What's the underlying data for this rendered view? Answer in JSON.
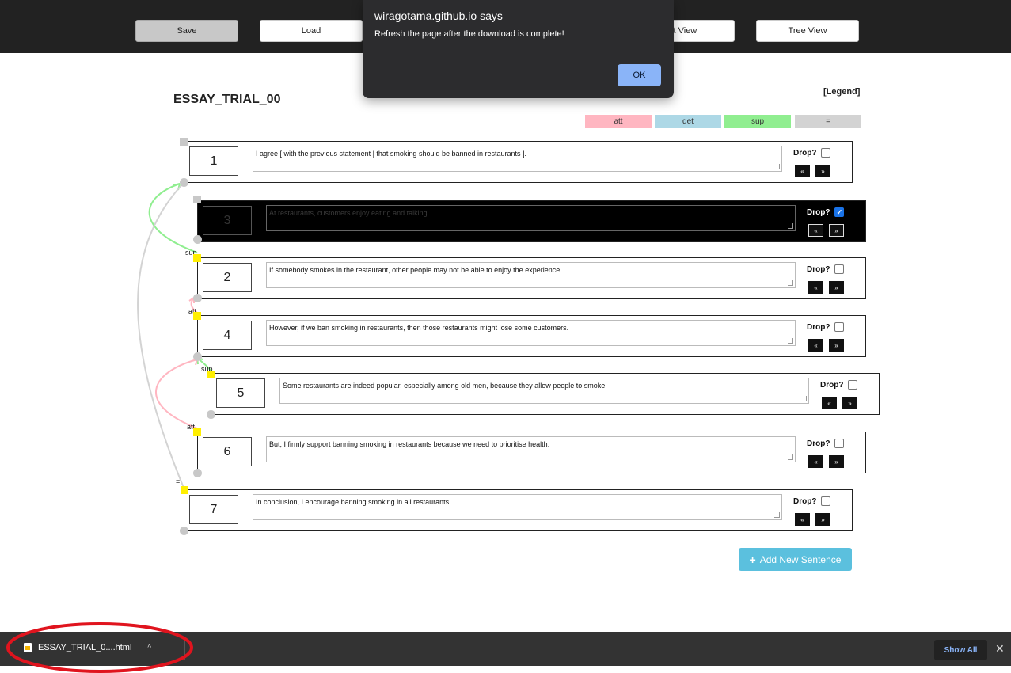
{
  "toolbar": {
    "buttons": [
      {
        "label": "Save"
      },
      {
        "label": "Load"
      },
      {
        "label": "xt View"
      },
      {
        "label": "Tree View"
      }
    ]
  },
  "dialog": {
    "title": "wiragotama.github.io says",
    "message": "Refresh the page after the download is complete!",
    "ok_label": "OK"
  },
  "essay": {
    "title": "ESSAY_TRIAL_00"
  },
  "legend": {
    "label": "[Legend]",
    "chips": [
      {
        "label": "att",
        "color": "#ffb6c1"
      },
      {
        "label": "det",
        "color": "#add8e6"
      },
      {
        "label": "sup",
        "color": "#90ee90"
      },
      {
        "label": "=",
        "color": "#d3d3d3"
      }
    ]
  },
  "sentences": [
    {
      "number": "1",
      "text": "I agree [ with the previous statement | that smoking should be banned in restaurants ].",
      "drop_label": "Drop?",
      "dropped": false,
      "prev_label": "«",
      "next_label": "»"
    },
    {
      "number": "3",
      "text": "At restaurants, customers enjoy eating and talking.",
      "drop_label": "Drop?",
      "dropped": true,
      "prev_label": "«",
      "next_label": "»"
    },
    {
      "number": "2",
      "text": "If somebody smokes in the restaurant, other people may not be able to enjoy the experience.",
      "drop_label": "Drop?",
      "dropped": false,
      "prev_label": "«",
      "next_label": "»"
    },
    {
      "number": "4",
      "text": "However, if we ban smoking in restaurants, then those restaurants might lose some customers.",
      "drop_label": "Drop?",
      "dropped": false,
      "prev_label": "«",
      "next_label": "»"
    },
    {
      "number": "5",
      "text": "Some restaurants are indeed popular, especially among old men, because they allow people to smoke.",
      "drop_label": "Drop?",
      "dropped": false,
      "prev_label": "«",
      "next_label": "»"
    },
    {
      "number": "6",
      "text": "But, I firmly support banning smoking in restaurants because we need to prioritise health.",
      "drop_label": "Drop?",
      "dropped": false,
      "prev_label": "«",
      "next_label": "»"
    },
    {
      "number": "7",
      "text": "In conclusion, I encourage banning smoking in all restaurants.",
      "drop_label": "Drop?",
      "dropped": false,
      "prev_label": "«",
      "next_label": "»"
    }
  ],
  "relations": [
    {
      "label": "sup",
      "color": "#90ee90"
    },
    {
      "label": "att",
      "color": "#ffb6c1"
    },
    {
      "label": "sup",
      "color": "#90ee90"
    },
    {
      "label": "att",
      "color": "#ffb6c1"
    },
    {
      "label": "=",
      "color": "#d3d3d3"
    }
  ],
  "add_button": {
    "label": "Add New Sentence",
    "icon": "plus-icon"
  },
  "download_bar": {
    "file_name": "ESSAY_TRIAL_0....html",
    "chevron": "^",
    "show_all_label": "Show All",
    "close_label": "✕"
  }
}
